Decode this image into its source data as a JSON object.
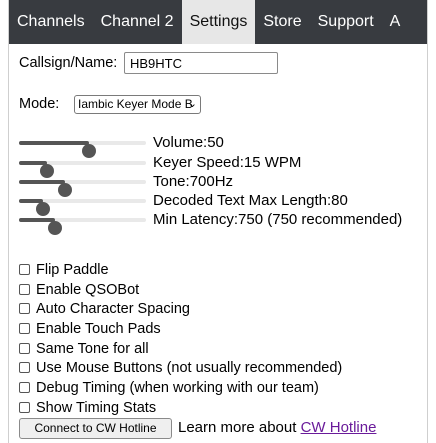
{
  "tabs": [
    {
      "label": "Channels",
      "active": false
    },
    {
      "label": "Channel 2",
      "active": false
    },
    {
      "label": "Settings",
      "active": true
    },
    {
      "label": "Store",
      "active": false
    },
    {
      "label": "Support",
      "active": false
    },
    {
      "label": "A",
      "active": false
    }
  ],
  "callsign": {
    "label": "Callsign/Name:",
    "value": "HB9HTC"
  },
  "mode": {
    "label": "Mode:",
    "selected": "Iambic Keyer Mode B"
  },
  "sliders": [
    {
      "label": "Volume:50",
      "fraction": 0.55
    },
    {
      "label": "Keyer Speed:15 WPM",
      "fraction": 0.22
    },
    {
      "label": "Tone:700Hz",
      "fraction": 0.36
    },
    {
      "label": "Decoded Text Max Length:80",
      "fraction": 0.19
    },
    {
      "label": "Min Latency:750 (750 recommended)",
      "fraction": 0.28
    }
  ],
  "checkboxes": [
    {
      "label": "Flip Paddle",
      "checked": false
    },
    {
      "label": "Enable QSOBot",
      "checked": false
    },
    {
      "label": "Auto Character Spacing",
      "checked": false
    },
    {
      "label": "Enable Touch Pads",
      "checked": false
    },
    {
      "label": "Same Tone for all",
      "checked": false
    },
    {
      "label": "Use Mouse Buttons (not usually recommended)",
      "checked": false
    },
    {
      "label": "Debug Timing (when working with our team)",
      "checked": false
    },
    {
      "label": "Show Timing Stats",
      "checked": false
    }
  ],
  "footer": {
    "connect_button": "Connect to CW Hotline",
    "learn_text": "Learn more about ",
    "link_text": "CW Hotline"
  },
  "colors": {
    "tabbar": "#383b40",
    "active_tab": "#e7e7e7",
    "slider": "#555555",
    "link": "#6a1b9a"
  }
}
